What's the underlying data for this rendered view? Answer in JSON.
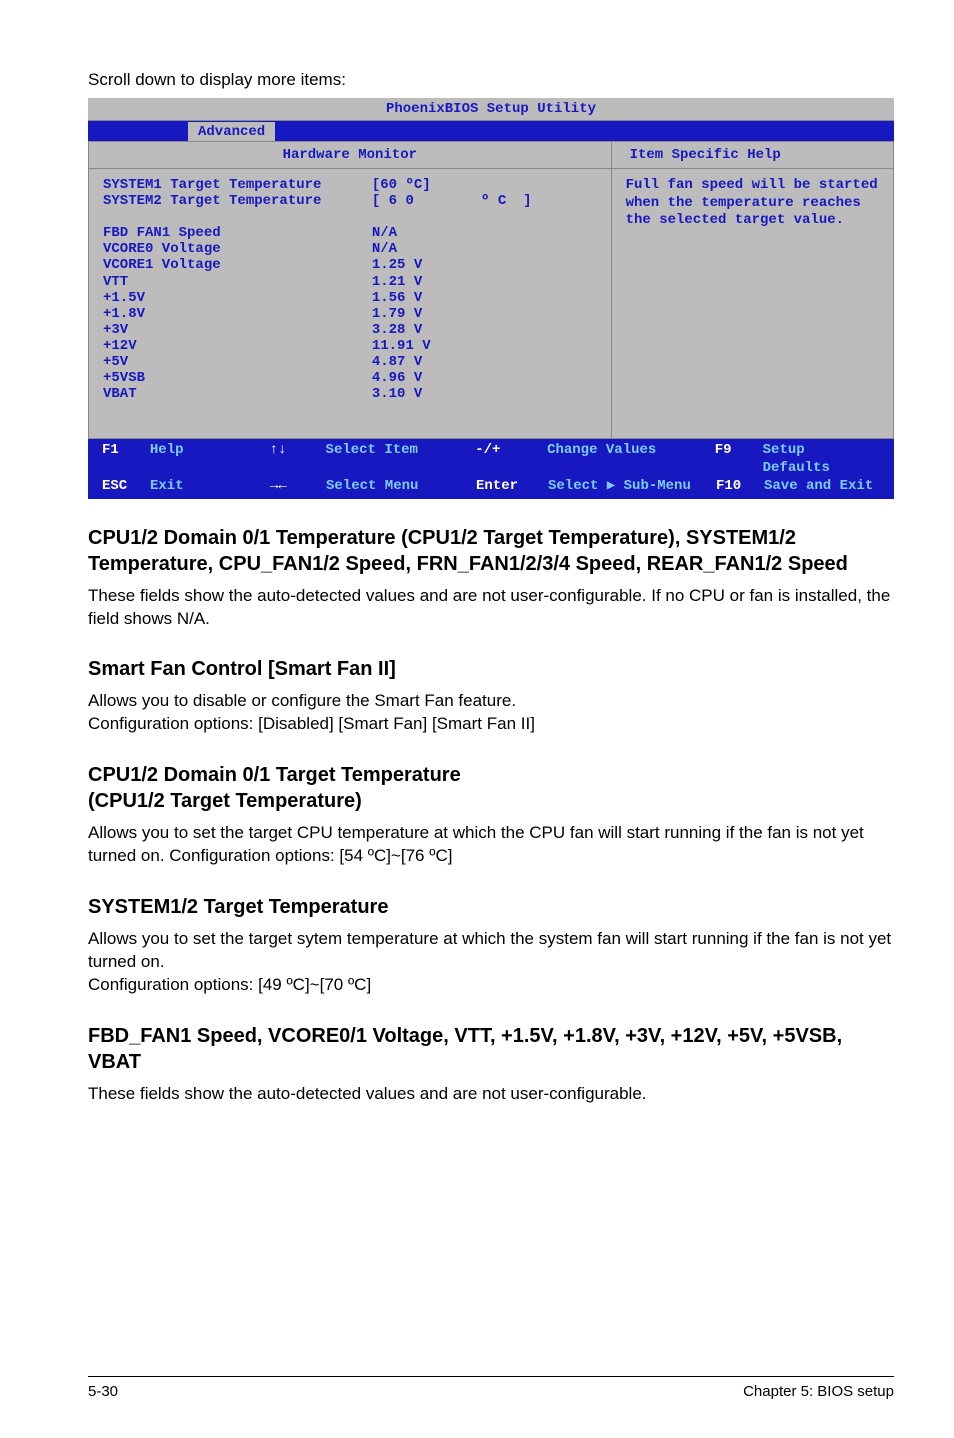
{
  "intro": "Scroll down to display more items:",
  "bios": {
    "title": "PhoenixBIOS Setup Utility",
    "tab": "Advanced",
    "panel_title": "Hardware Monitor",
    "help_title": "Item Specific Help",
    "help_body": "Full fan speed will be started when the temperature reaches the selected target value.",
    "footer": {
      "f1": "F1",
      "help": "Help",
      "updn": "↑↓",
      "seli": "Select Item",
      "pm": "-/+",
      "chv": "Change Values",
      "f9": "F9",
      "setdef": "Setup Defaults",
      "esc": "ESC",
      "exit": "Exit",
      "lr": "→←",
      "selm": "Select Menu",
      "enter": "Enter",
      "subm": "Select ▶ Sub-Menu",
      "f10": "F10",
      "save": "Save and Exit"
    }
  },
  "chart_data": {
    "type": "table",
    "rows": [
      {
        "label": "SYSTEM1 Target Temperature",
        "value": "[60 ºC]"
      },
      {
        "label": "SYSTEM2 Target Temperature",
        "value": "[ 6 0        º C  ]"
      },
      {
        "label": "",
        "value": ""
      },
      {
        "label": "FBD FAN1 Speed",
        "value": "N/A"
      },
      {
        "label": "VCORE0 Voltage",
        "value": "N/A"
      },
      {
        "label": "VCORE1 Voltage",
        "value": "1.25 V"
      },
      {
        "label": "VTT",
        "value": "1.21 V"
      },
      {
        "label": "+1.5V",
        "value": "1.56 V"
      },
      {
        "label": "+1.8V",
        "value": "1.79 V"
      },
      {
        "label": "+3V",
        "value": "3.28 V"
      },
      {
        "label": "+12V",
        "value": "11.91 V"
      },
      {
        "label": "+5V",
        "value": "4.87 V"
      },
      {
        "label": "+5VSB",
        "value": "4.96 V"
      },
      {
        "label": "VBAT",
        "value": "3.10 V"
      }
    ]
  },
  "sections": {
    "s1_title": "CPU1/2 Domain 0/1 Temperature (CPU1/2 Target Temperature), SYSTEM1/2 Temperature, CPU_FAN1/2 Speed, FRN_FAN1/2/3/4 Speed, REAR_FAN1/2 Speed",
    "s1_body": "These fields show the auto-detected values and are not user-configurable. If no CPU or fan is installed, the field shows N/A.",
    "s2_title": "Smart Fan Control [Smart Fan II]",
    "s2_body": "Allows you to disable or configure the Smart Fan feature.\nConfiguration options: [Disabled] [Smart Fan] [Smart Fan II]",
    "s3_title": "CPU1/2 Domain 0/1 Target Temperature\n(CPU1/2 Target Temperature)",
    "s3_body": "Allows you to set the target CPU temperature at which the CPU fan will start running if the fan is not yet turned on. Configuration options: [54 ºC]~[76 ºC]",
    "s4_title": "SYSTEM1/2 Target Temperature",
    "s4_body": "Allows you to set the target sytem temperature at which the system fan will start running if the fan is not yet turned on.\nConfiguration options: [49 ºC]~[70 ºC]",
    "s5_title": "FBD_FAN1 Speed, VCORE0/1 Voltage, VTT, +1.5V, +1.8V, +3V, +12V, +5V, +5VSB, VBAT",
    "s5_body": "These fields show the auto-detected values and are not user-configurable."
  },
  "footer": {
    "left": "5-30",
    "right": "Chapter 5: BIOS setup"
  }
}
